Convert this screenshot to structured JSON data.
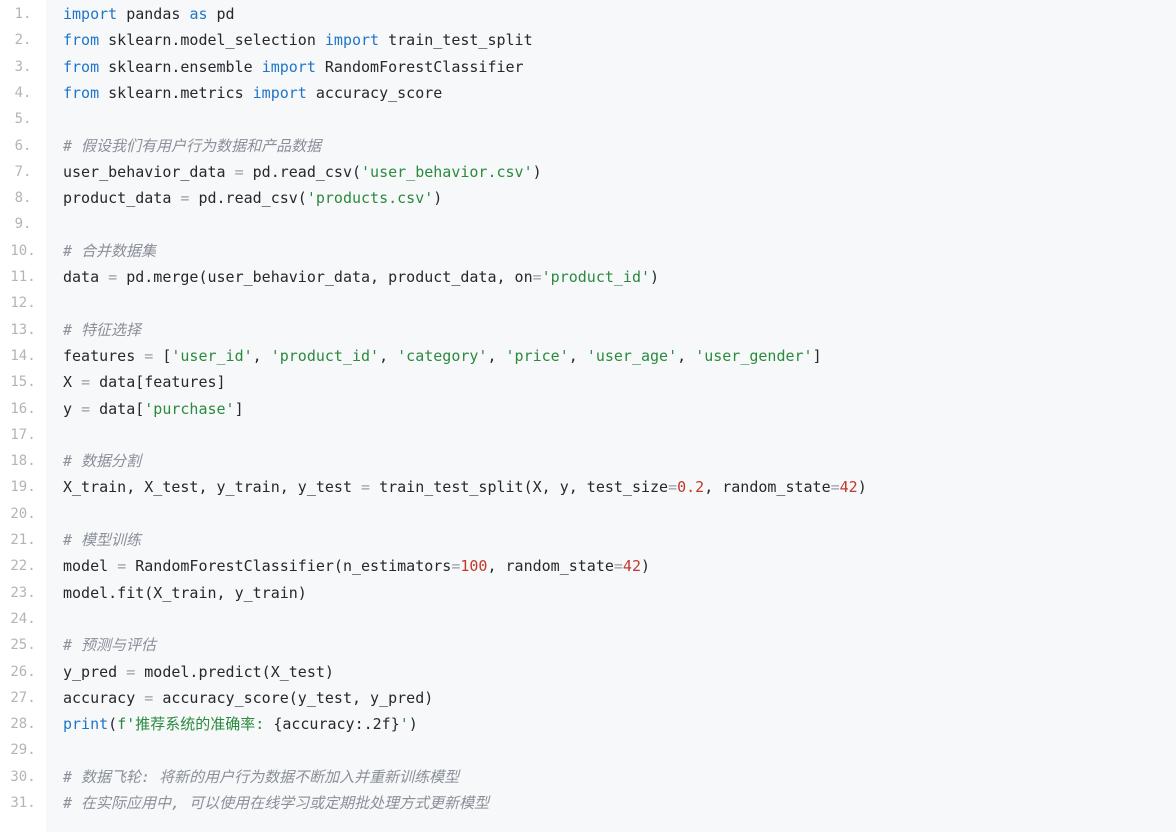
{
  "lines": [
    {
      "n": "1.",
      "tokens": [
        [
          "kw",
          "import"
        ],
        [
          "t",
          " pandas "
        ],
        [
          "kw",
          "as"
        ],
        [
          "t",
          " pd"
        ]
      ]
    },
    {
      "n": "2.",
      "tokens": [
        [
          "kw",
          "from"
        ],
        [
          "t",
          " sklearn.model_selection "
        ],
        [
          "kw",
          "import"
        ],
        [
          "t",
          " train_test_split"
        ]
      ]
    },
    {
      "n": "3.",
      "tokens": [
        [
          "kw",
          "from"
        ],
        [
          "t",
          " sklearn.ensemble "
        ],
        [
          "kw",
          "import"
        ],
        [
          "t",
          " RandomForestClassifier"
        ]
      ]
    },
    {
      "n": "4.",
      "tokens": [
        [
          "kw",
          "from"
        ],
        [
          "t",
          " sklearn.metrics "
        ],
        [
          "kw",
          "import"
        ],
        [
          "t",
          " accuracy_score"
        ]
      ]
    },
    {
      "n": "5.",
      "tokens": []
    },
    {
      "n": "6.",
      "tokens": [
        [
          "cm",
          "# 假设我们有用户行为数据和产品数据"
        ]
      ]
    },
    {
      "n": "7.",
      "tokens": [
        [
          "t",
          "user_behavior_data "
        ],
        [
          "op",
          "="
        ],
        [
          "t",
          " pd.read_csv("
        ],
        [
          "str",
          "'user_behavior.csv'"
        ],
        [
          "t",
          ")"
        ]
      ]
    },
    {
      "n": "8.",
      "tokens": [
        [
          "t",
          "product_data "
        ],
        [
          "op",
          "="
        ],
        [
          "t",
          " pd.read_csv("
        ],
        [
          "str",
          "'products.csv'"
        ],
        [
          "t",
          ")"
        ]
      ]
    },
    {
      "n": "9.",
      "tokens": []
    },
    {
      "n": "10.",
      "tokens": [
        [
          "cm",
          "# 合并数据集"
        ]
      ]
    },
    {
      "n": "11.",
      "tokens": [
        [
          "t",
          "data "
        ],
        [
          "op",
          "="
        ],
        [
          "t",
          " pd.merge(user_behavior_data, product_data, on"
        ],
        [
          "op",
          "="
        ],
        [
          "str",
          "'product_id'"
        ],
        [
          "t",
          ")"
        ]
      ]
    },
    {
      "n": "12.",
      "tokens": []
    },
    {
      "n": "13.",
      "tokens": [
        [
          "cm",
          "# 特征选择"
        ]
      ]
    },
    {
      "n": "14.",
      "tokens": [
        [
          "t",
          "features "
        ],
        [
          "op",
          "="
        ],
        [
          "t",
          " ["
        ],
        [
          "str",
          "'user_id'"
        ],
        [
          "t",
          ", "
        ],
        [
          "str",
          "'product_id'"
        ],
        [
          "t",
          ", "
        ],
        [
          "str",
          "'category'"
        ],
        [
          "t",
          ", "
        ],
        [
          "str",
          "'price'"
        ],
        [
          "t",
          ", "
        ],
        [
          "str",
          "'user_age'"
        ],
        [
          "t",
          ", "
        ],
        [
          "str",
          "'user_gender'"
        ],
        [
          "t",
          "]"
        ]
      ]
    },
    {
      "n": "15.",
      "tokens": [
        [
          "t",
          "X "
        ],
        [
          "op",
          "="
        ],
        [
          "t",
          " data[features]"
        ]
      ]
    },
    {
      "n": "16.",
      "tokens": [
        [
          "t",
          "y "
        ],
        [
          "op",
          "="
        ],
        [
          "t",
          " data["
        ],
        [
          "str",
          "'purchase'"
        ],
        [
          "t",
          "]"
        ]
      ]
    },
    {
      "n": "17.",
      "tokens": []
    },
    {
      "n": "18.",
      "tokens": [
        [
          "cm",
          "# 数据分割"
        ]
      ]
    },
    {
      "n": "19.",
      "tokens": [
        [
          "t",
          "X_train, X_test, y_train, y_test "
        ],
        [
          "op",
          "="
        ],
        [
          "t",
          " train_test_split(X, y, test_size"
        ],
        [
          "op",
          "="
        ],
        [
          "num",
          "0.2"
        ],
        [
          "t",
          ", random_state"
        ],
        [
          "op",
          "="
        ],
        [
          "num",
          "42"
        ],
        [
          "t",
          ")"
        ]
      ]
    },
    {
      "n": "20.",
      "tokens": []
    },
    {
      "n": "21.",
      "tokens": [
        [
          "cm",
          "# 模型训练"
        ]
      ]
    },
    {
      "n": "22.",
      "tokens": [
        [
          "t",
          "model "
        ],
        [
          "op",
          "="
        ],
        [
          "t",
          " RandomForestClassifier(n_estimators"
        ],
        [
          "op",
          "="
        ],
        [
          "num",
          "100"
        ],
        [
          "t",
          ", random_state"
        ],
        [
          "op",
          "="
        ],
        [
          "num",
          "42"
        ],
        [
          "t",
          ")"
        ]
      ]
    },
    {
      "n": "23.",
      "tokens": [
        [
          "t",
          "model.fit(X_train, y_train)"
        ]
      ]
    },
    {
      "n": "24.",
      "tokens": []
    },
    {
      "n": "25.",
      "tokens": [
        [
          "cm",
          "# 预测与评估"
        ]
      ]
    },
    {
      "n": "26.",
      "tokens": [
        [
          "t",
          "y_pred "
        ],
        [
          "op",
          "="
        ],
        [
          "t",
          " model.predict(X_test)"
        ]
      ]
    },
    {
      "n": "27.",
      "tokens": [
        [
          "t",
          "accuracy "
        ],
        [
          "op",
          "="
        ],
        [
          "t",
          " accuracy_score(y_test, y_pred)"
        ]
      ]
    },
    {
      "n": "28.",
      "tokens": [
        [
          "kw",
          "print"
        ],
        [
          "t",
          "("
        ],
        [
          "str",
          "f'推荐系统的准确率: "
        ],
        [
          "t",
          "{accuracy:.2f}"
        ],
        [
          "str",
          "'"
        ],
        [
          "t",
          ")"
        ]
      ]
    },
    {
      "n": "29.",
      "tokens": []
    },
    {
      "n": "30.",
      "tokens": [
        [
          "cm",
          "# 数据飞轮: 将新的用户行为数据不断加入并重新训练模型"
        ]
      ]
    },
    {
      "n": "31.",
      "tokens": [
        [
          "cm",
          "# 在实际应用中, 可以使用在线学习或定期批处理方式更新模型"
        ]
      ]
    }
  ]
}
